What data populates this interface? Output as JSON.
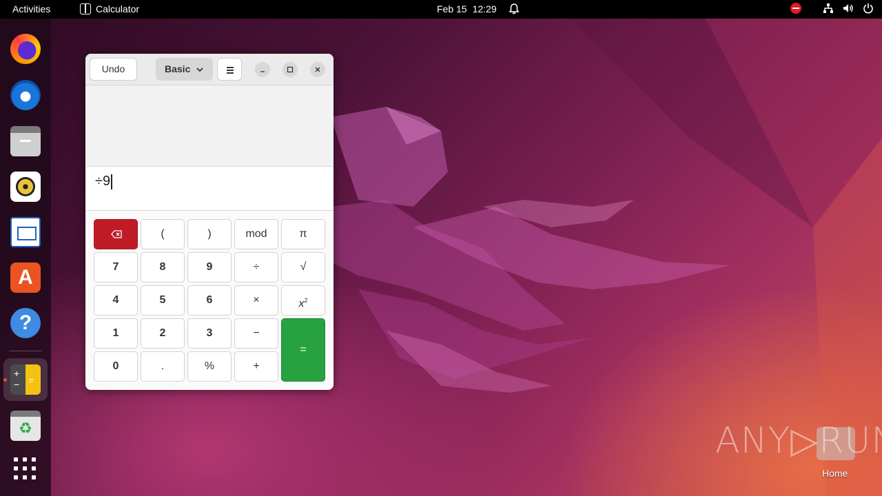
{
  "topbar": {
    "activities": "Activities",
    "app_name": "Calculator",
    "date": "Feb 15",
    "time": "12:29"
  },
  "dock": {
    "items": [
      "firefox-icon",
      "thunderbird-icon",
      "files-icon",
      "rhythmbox-icon",
      "libreoffice-writer-icon",
      "app-center-icon",
      "help-icon",
      "calculator-icon",
      "trash-icon",
      "show-apps-icon"
    ],
    "help_glyph": "?",
    "store_glyph": "A",
    "trash_glyph": "♻"
  },
  "calculator": {
    "undo_label": "Undo",
    "mode_label": "Basic",
    "expression": "÷9",
    "keys": {
      "paren_open": "(",
      "paren_close": ")",
      "mod": "mod",
      "pi": "π",
      "k7": "7",
      "k8": "8",
      "k9": "9",
      "divide": "÷",
      "sqrt": "√",
      "k4": "4",
      "k5": "5",
      "k6": "6",
      "multiply": "×",
      "square_base": "x",
      "square_exp": "2",
      "k1": "1",
      "k2": "2",
      "k3": "3",
      "subtract": "−",
      "equals": "=",
      "k0": "0",
      "decimal": ".",
      "percent": "%",
      "add": "+"
    },
    "colors": {
      "delete": "#c01c28",
      "equals": "#26a241"
    }
  },
  "desktop": {
    "watermark": "ANY▷RUN",
    "home_label": "Home"
  }
}
